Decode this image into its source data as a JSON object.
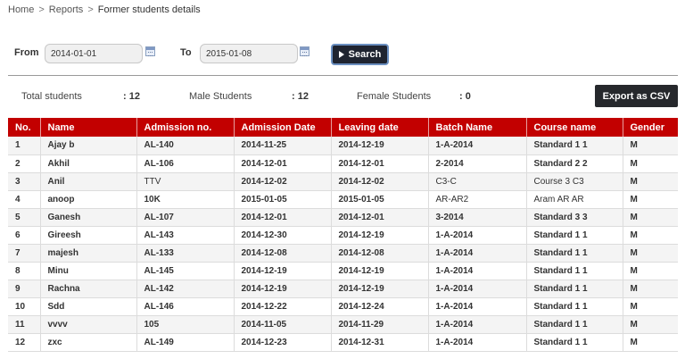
{
  "breadcrumb": {
    "home": "Home",
    "separator": ">",
    "reports": "Reports",
    "current": "Former students details"
  },
  "filter": {
    "from_label": "From",
    "from_value": "2014-01-01",
    "to_label": "To",
    "to_value": "2015-01-08",
    "search_label": "Search",
    "calendar_icon": "calendar-icon",
    "search_icon": "play-icon"
  },
  "summary": {
    "total_label": "Total students",
    "total_value": ": 12",
    "male_label": "Male Students",
    "male_value": ": 12",
    "female_label": "Female Students",
    "female_value": ": 0"
  },
  "export_label": "Export as CSV",
  "colors": {
    "header_bg": "#c20000",
    "button_dark": "#26282c",
    "search_border": "#6b8fc0"
  },
  "table": {
    "columns": [
      "No.",
      "Name",
      "Admission no.",
      "Admission Date",
      "Leaving date",
      "Batch Name",
      "Course name",
      "Gender"
    ],
    "rows": [
      [
        "1",
        "Ajay b",
        "AL-140",
        "2014-11-25",
        "2014-12-19",
        "1-A-2014",
        "Standard 1 1",
        "M"
      ],
      [
        "2",
        "Akhil",
        "AL-106",
        "2014-12-01",
        "2014-12-01",
        "2-2014",
        "Standard 2 2",
        "M"
      ],
      [
        "3",
        "Anil",
        "TTV",
        "2014-12-02",
        "2014-12-02",
        "C3-C",
        "Course 3 C3",
        "M"
      ],
      [
        "4",
        "anoop",
        "10K",
        "2015-01-05",
        "2015-01-05",
        "AR-AR2",
        "Aram AR AR",
        "M"
      ],
      [
        "5",
        "Ganesh",
        "AL-107",
        "2014-12-01",
        "2014-12-01",
        "3-2014",
        "Standard 3 3",
        "M"
      ],
      [
        "6",
        "Gireesh",
        "AL-143",
        "2014-12-30",
        "2014-12-19",
        "1-A-2014",
        "Standard 1 1",
        "M"
      ],
      [
        "7",
        "majesh",
        "AL-133",
        "2014-12-08",
        "2014-12-08",
        "1-A-2014",
        "Standard 1 1",
        "M"
      ],
      [
        "8",
        "Minu",
        "AL-145",
        "2014-12-19",
        "2014-12-19",
        "1-A-2014",
        "Standard 1 1",
        "M"
      ],
      [
        "9",
        "Rachna",
        "AL-142",
        "2014-12-19",
        "2014-12-19",
        "1-A-2014",
        "Standard 1 1",
        "M"
      ],
      [
        "10",
        "Sdd",
        "AL-146",
        "2014-12-22",
        "2014-12-24",
        "1-A-2014",
        "Standard 1 1",
        "M"
      ],
      [
        "11",
        "vvvv",
        "105",
        "2014-11-05",
        "2014-11-29",
        "1-A-2014",
        "Standard 1 1",
        "M"
      ],
      [
        "12",
        "zxc",
        "AL-149",
        "2014-12-23",
        "2014-12-31",
        "1-A-2014",
        "Standard 1 1",
        "M"
      ]
    ]
  }
}
